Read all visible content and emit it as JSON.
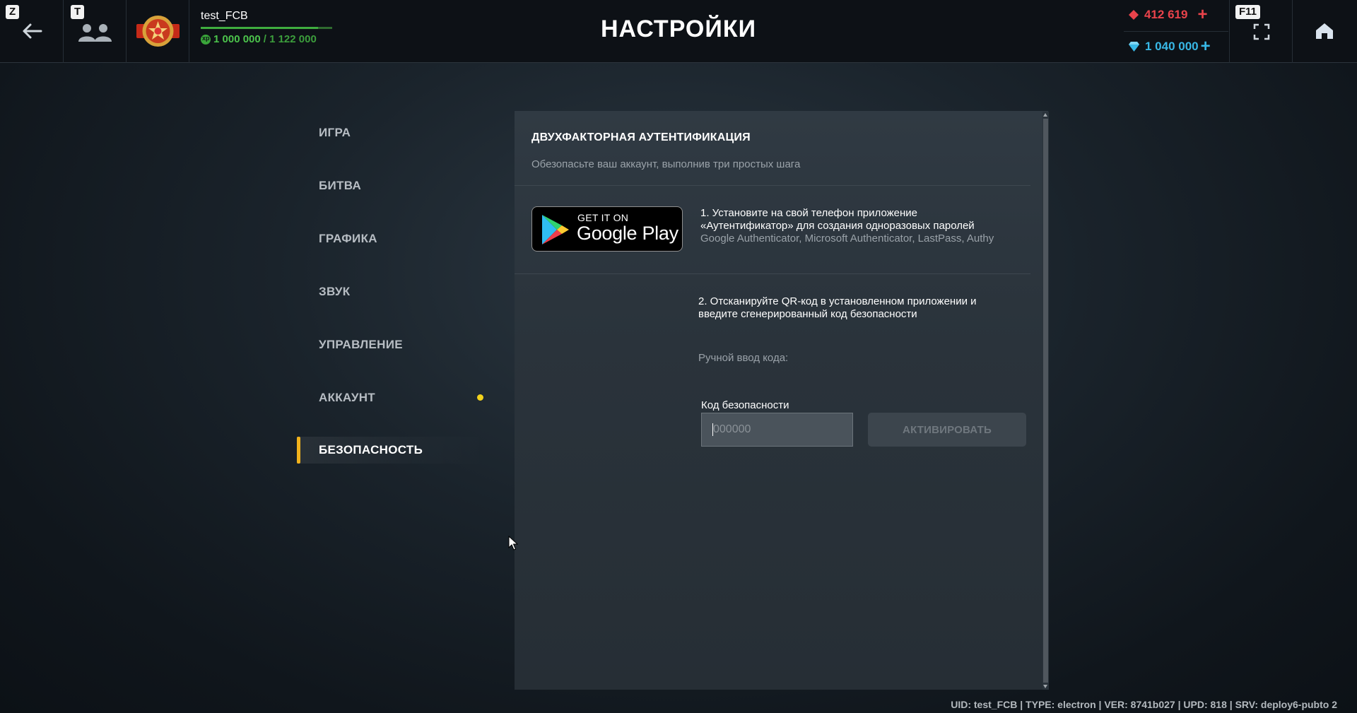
{
  "topbar": {
    "back_key": "Z",
    "friends_key": "T",
    "fullscreen_key": "F11",
    "player_name": "test_FCB",
    "xp_current": "1 000 000",
    "xp_max": "/ 1 122 000",
    "xp_progress": 0.891,
    "title": "НАСТРОЙКИ",
    "gold": "412 619",
    "gold_plus": "+",
    "gems": "1 040 000",
    "gems_plus": "+"
  },
  "menu": {
    "items": [
      {
        "label": "ИГРА"
      },
      {
        "label": "БИТВА"
      },
      {
        "label": "ГРАФИКА"
      },
      {
        "label": "ЗВУК"
      },
      {
        "label": "УПРАВЛЕНИЕ"
      },
      {
        "label": "АККАУНТ"
      },
      {
        "label": "БЕЗОПАСНОСТЬ"
      }
    ],
    "active": "БЕЗОПАСНОСТЬ"
  },
  "panel": {
    "title": "ДВУХФАКТОРНАЯ АУТЕНТИФИКАЦИЯ",
    "subtitle": "Обезопасьте ваш аккаунт, выполнив три простых шага",
    "google_play_small": "GET IT ON",
    "google_play_big": "Google Play",
    "step1_line1": "1. Установите на свой телефон приложение",
    "step1_line2": "«Аутентификатор» для создания одноразовых паролей",
    "step1_apps": "Google Authenticator, Microsoft Authenticator, LastPass, Authy",
    "step2_line1": "2. Отсканируйте QR-код в установленном приложении и",
    "step2_line2": "введите сгенерированный код безопасности",
    "manual_label": "Ручной ввод кода:",
    "code_label": "Код безопасности",
    "code_placeholder": "000000",
    "code_value": "",
    "activate_label": "АКТИВИРОВАТЬ"
  },
  "footer": {
    "info": "UID: test_FCB | TYPE: electron | VER: 8741b027 | UPD: 818 | SRV: deploy6-pubto 2"
  },
  "colors": {
    "accent": "#f1b21c",
    "gold": "#e9434b",
    "gems": "#38b8e6",
    "xp": "#4cc44c",
    "notification": "#f2d21c"
  },
  "icons": [
    "back-arrow-icon",
    "friends-icon",
    "rank-emblem-icon",
    "xp-icon",
    "gold-icon",
    "gem-icon",
    "fullscreen-icon",
    "home-icon",
    "google-play-icon",
    "mouse-cursor-icon"
  ]
}
